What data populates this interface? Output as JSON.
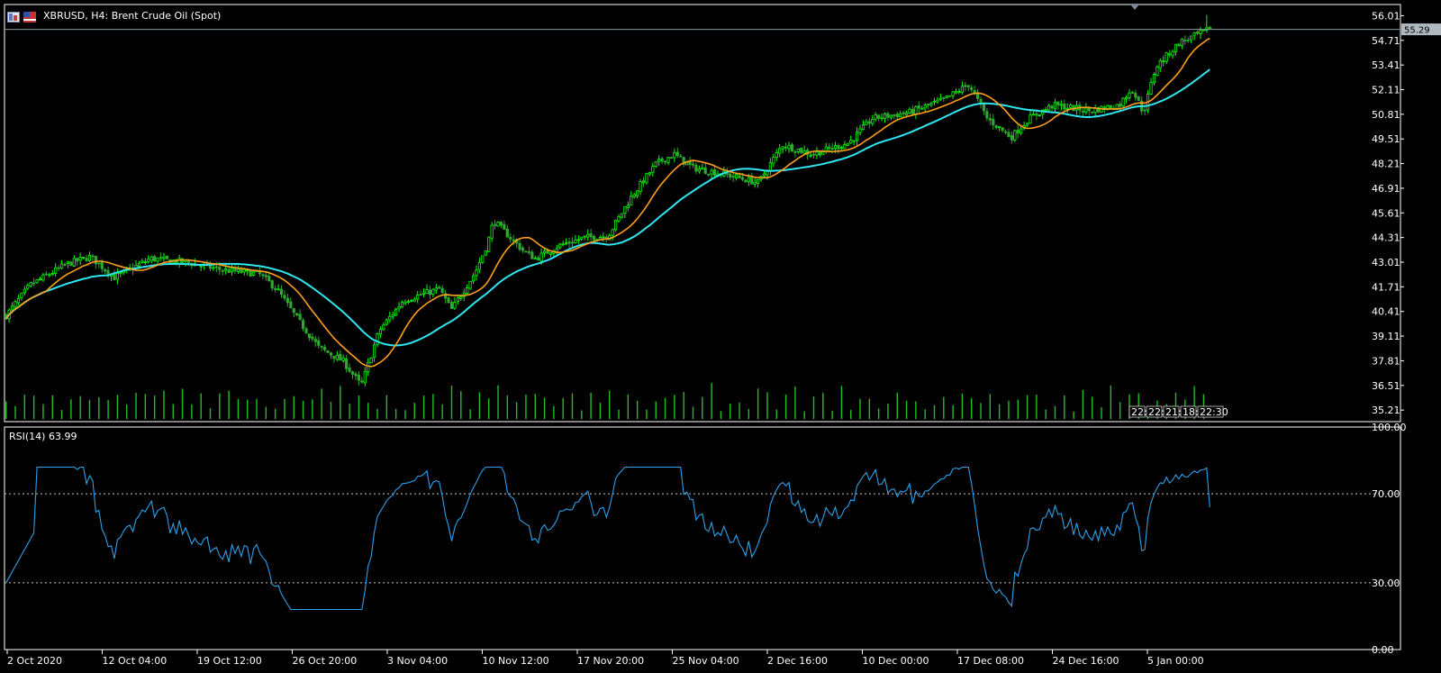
{
  "window": {
    "symbol_title": "XBRUSD, H4:  Brent Crude Oil (Spot)"
  },
  "colors": {
    "background": "#000000",
    "bull_candle": "#00ff00",
    "bear_candle": "#2ea82e",
    "volume": "#22c022",
    "ma_fast": "#ff9f1c",
    "ma_slow": "#2fe6f0",
    "rsi_line": "#2ea0e8",
    "grid_dashed": "#c8c8c8",
    "axis_border": "#ffffff",
    "current_price_tag": "#b0b8c0"
  },
  "icons": [
    "window-icon",
    "flag-icon"
  ],
  "main_panel": {
    "price_ticks": [
      "56.01",
      "54.71",
      "53.41",
      "52.11",
      "50.81",
      "49.51",
      "48.21",
      "46.91",
      "45.61",
      "44.31",
      "43.01",
      "41.71",
      "40.41",
      "39.11",
      "37.81",
      "36.51",
      "35.21"
    ],
    "current_price": "55.29",
    "countdown_labels": [
      "22:",
      "22:",
      "21:",
      "18:",
      "22:30"
    ]
  },
  "rsi_panel": {
    "label": "RSI(14) 63.99",
    "ticks": [
      "100.00",
      "70.00",
      "30.00",
      "0.00"
    ]
  },
  "time_axis": {
    "labels": [
      "2 Oct 2020",
      "12 Oct 04:00",
      "19 Oct 12:00",
      "26 Oct 20:00",
      "3 Nov 04:00",
      "10 Nov 12:00",
      "17 Nov 20:00",
      "25 Nov 04:00",
      "2 Dec 16:00",
      "10 Dec 00:00",
      "17 Dec 08:00",
      "24 Dec 16:00",
      "5 Jan 00:00"
    ]
  },
  "chart_data": {
    "type": "candlestick",
    "symbol": "XBRUSD",
    "timeframe": "H4",
    "y_range_main": [
      34.6,
      56.6
    ],
    "y_range_rsi": [
      0,
      100
    ],
    "rsi_levels": [
      30,
      70
    ],
    "key_points": {
      "start_close": 40.2,
      "october_plateau": 43.0,
      "late_october_low": 36.5,
      "mid_november_high": 45.2,
      "late_november_high": 48.7,
      "mid_december_high": 52.4,
      "late_december": 51.0,
      "last_close": 55.29,
      "last_high": 56.05
    },
    "rsi_key_points": {
      "start": 30,
      "late_october_low": 22,
      "mid_november_high": 78,
      "late_november_high": 80,
      "mid_december": 72,
      "last": 63.99
    }
  }
}
